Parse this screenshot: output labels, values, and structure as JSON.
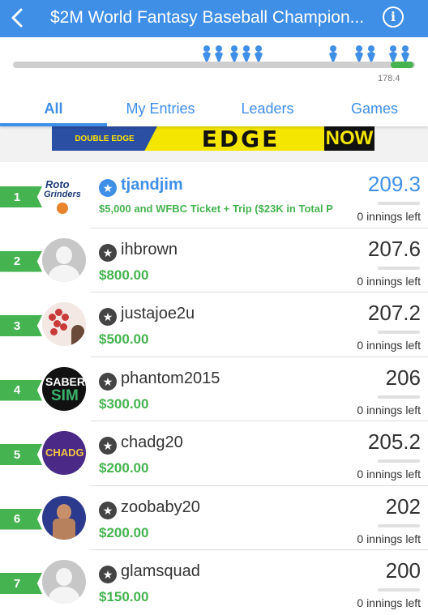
{
  "header": {
    "title": "$2M World Fantasy Baseball Champion...",
    "back_icon": "chevron-left-icon",
    "info_icon": "info-icon",
    "info_glyph": "i"
  },
  "progress": {
    "marker_label": "178.4",
    "people_icon": "person-icon"
  },
  "tabs": [
    {
      "label": "All",
      "active": true
    },
    {
      "label": "My Entries",
      "active": false
    },
    {
      "label": "Leaders",
      "active": false
    },
    {
      "label": "Games",
      "active": false
    }
  ],
  "banner": {
    "left_text": "DOUBLE EDGE",
    "middle_text": "EDGE",
    "right_text": "NOW"
  },
  "entries": [
    {
      "rank": "1",
      "username": "tjandjim",
      "prize": "$5,000 and WFBC Ticket + Trip ($23K in Total P",
      "score": "209.3",
      "innings": "0 innings left",
      "highlight": true
    },
    {
      "rank": "2",
      "username": "ihbrown",
      "prize": "$800.00",
      "score": "207.6",
      "innings": "0 innings left",
      "highlight": false
    },
    {
      "rank": "3",
      "username": "justajoe2u",
      "prize": "$500.00",
      "score": "207.2",
      "innings": "0 innings left",
      "highlight": false
    },
    {
      "rank": "4",
      "username": "phantom2015",
      "prize": "$300.00",
      "score": "206",
      "innings": "0 innings left",
      "highlight": false
    },
    {
      "rank": "5",
      "username": "chadg20",
      "prize": "$200.00",
      "score": "205.2",
      "innings": "0 innings left",
      "highlight": false
    },
    {
      "rank": "6",
      "username": "zoobaby20",
      "prize": "$200.00",
      "score": "202",
      "innings": "0 innings left",
      "highlight": false
    },
    {
      "rank": "7",
      "username": "glamsquad",
      "prize": "$150.00",
      "score": "200",
      "innings": "0 innings left",
      "highlight": false
    }
  ],
  "avatars": {
    "roto": {
      "line1": "Roto",
      "line2": "Grinders"
    },
    "saber": {
      "line1": "SABER",
      "line2": "SIM"
    },
    "chadg": {
      "text": "CHADG"
    }
  },
  "star_glyph": "★",
  "colors": {
    "accent": "#3f8fe6",
    "money": "#45b34f",
    "rank_badge": "#45b34f"
  }
}
